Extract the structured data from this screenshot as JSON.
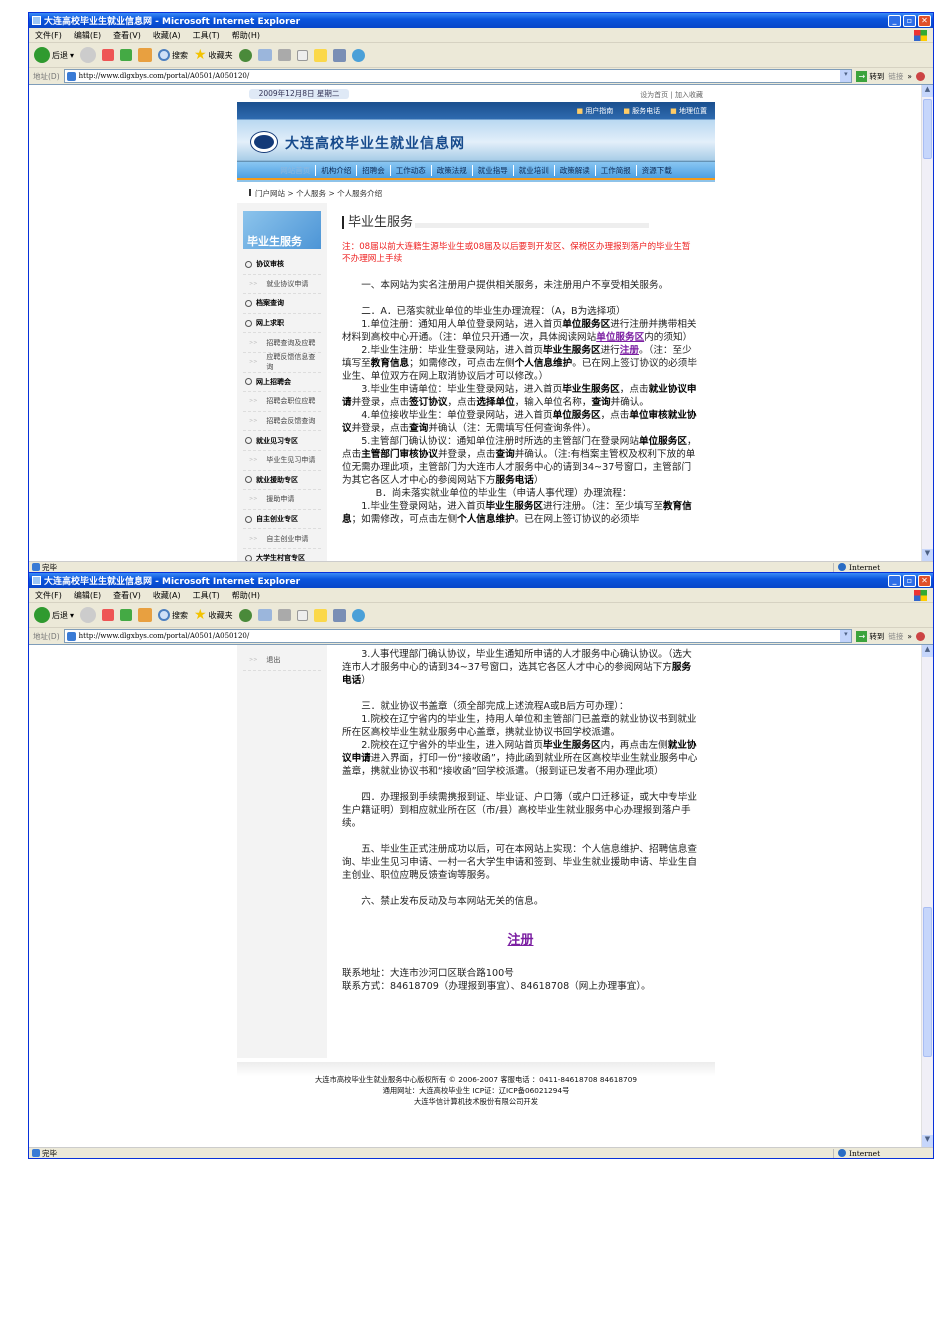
{
  "browser": {
    "title": "大连高校毕业生就业信息网 - Microsoft Internet Explorer",
    "menu": [
      "文件(F)",
      "编辑(E)",
      "查看(V)",
      "收藏(A)",
      "工具(T)",
      "帮助(H)"
    ],
    "toolbar": {
      "back": "后退",
      "search": "搜索",
      "favorites": "收藏夹"
    },
    "address": {
      "label": "地址(D)",
      "url": "http://www.dlgxbys.com/portal/A0501/A050120/",
      "go": "转到",
      "links": "链接"
    },
    "status": {
      "text": "完毕",
      "zone": "Internet"
    }
  },
  "page": {
    "date": "2009年12月8日 星期二",
    "top_links": [
      "设为首页",
      "加入收藏"
    ],
    "util_links": [
      "用户指南",
      "服务电话",
      "地理位置"
    ],
    "site_title": "大连高校毕业生就业信息网",
    "nav": [
      "网站首页",
      "机构介绍",
      "招聘会",
      "工作动态",
      "政策法规",
      "就业指导",
      "就业培训",
      "政策解读",
      "工作简报",
      "资源下载"
    ],
    "breadcrumb": [
      "门户网站",
      "个人服务",
      "个人服务介绍"
    ],
    "sidebar": {
      "header": "毕业生服务",
      "items": [
        {
          "label": "协议审核",
          "type": "sec"
        },
        {
          "label": "就业协议申请",
          "type": "sub"
        },
        {
          "label": "档案查询",
          "type": "sec"
        },
        {
          "label": "网上求职",
          "type": "sec"
        },
        {
          "label": "招聘查询及应聘",
          "type": "sub"
        },
        {
          "label": "应聘反馈信息查询",
          "type": "sub"
        },
        {
          "label": "网上招聘会",
          "type": "sec"
        },
        {
          "label": "招聘会职位应聘",
          "type": "sub"
        },
        {
          "label": "招聘会反馈查询",
          "type": "sub"
        },
        {
          "label": "就业见习专区",
          "type": "sec"
        },
        {
          "label": "毕业生见习申请",
          "type": "sub"
        },
        {
          "label": "就业援助专区",
          "type": "sec"
        },
        {
          "label": "援助申请",
          "type": "sub"
        },
        {
          "label": "自主创业专区",
          "type": "sec"
        },
        {
          "label": "自主创业申请",
          "type": "sub"
        },
        {
          "label": "大学生村官专区",
          "type": "sec"
        }
      ],
      "logout": "退出"
    },
    "main_title": "毕业生服务",
    "notice": "注：08届以前大连籍生源毕业生或08届及以后要到开发区、保税区办理报到落户的毕业生暂不办理网上手续",
    "paras_top": [
      {
        "cls": "",
        "seg": [
          [
            "t",
            "一、本网站为实名注册用户提供相关服务，未注册用户不享受相关服务。"
          ]
        ]
      },
      {
        "cls": "gap",
        "seg": [
          [
            "t",
            "二．A．已落实就业单位的毕业生办理流程：（A，B为选择项）"
          ]
        ]
      },
      {
        "cls": "",
        "seg": [
          [
            "t",
            "1.单位注册：通知用人单位登录网站，进入首页"
          ],
          [
            "b",
            "单位服务区"
          ],
          [
            "t",
            "进行注册并携带相关材料到高校中心开通。（注：单位只开通一次，具体阅读网站"
          ],
          [
            "a",
            "单位服务区"
          ],
          [
            "t",
            "内的须知）"
          ]
        ]
      },
      {
        "cls": "",
        "seg": [
          [
            "t",
            "2.毕业生注册：毕业生登录网站，进入首页"
          ],
          [
            "b",
            "毕业生服务区"
          ],
          [
            "t",
            "进行"
          ],
          [
            "a",
            "注册"
          ],
          [
            "t",
            "。（注：至少填写至"
          ],
          [
            "b",
            "教育信息"
          ],
          [
            "t",
            "；如需修改，可点击左侧"
          ],
          [
            "b",
            "个人信息维护"
          ],
          [
            "t",
            "。已在网上签订协议的必须毕业生、单位双方在网上取消协议后才可以修改。）"
          ]
        ]
      },
      {
        "cls": "",
        "seg": [
          [
            "t",
            "3.毕业生申请单位：毕业生登录网站，进入首页"
          ],
          [
            "b",
            "毕业生服务区"
          ],
          [
            "t",
            "，点击"
          ],
          [
            "b",
            "就业协议申请"
          ],
          [
            "t",
            "并登录，点击"
          ],
          [
            "b",
            "签订协议"
          ],
          [
            "t",
            "，点击"
          ],
          [
            "b",
            "选择单位"
          ],
          [
            "t",
            "，输入单位名称，"
          ],
          [
            "b",
            "查询"
          ],
          [
            "t",
            "并确认。"
          ]
        ]
      },
      {
        "cls": "",
        "seg": [
          [
            "t",
            "4.单位接收毕业生：单位登录网站，进入首页"
          ],
          [
            "b",
            "单位服务区"
          ],
          [
            "t",
            "，点击"
          ],
          [
            "b",
            "单位审核就业协议"
          ],
          [
            "t",
            "并登录，点击"
          ],
          [
            "b",
            "查询"
          ],
          [
            "t",
            "并确认（注：无需填写任何查询条件）。"
          ]
        ]
      },
      {
        "cls": "",
        "seg": [
          [
            "t",
            "5.主管部门确认协议：通知单位注册时所选的主管部门在登录网站"
          ],
          [
            "b",
            "单位服务区"
          ],
          [
            "t",
            "，点击"
          ],
          [
            "b",
            "主管部门审核协议"
          ],
          [
            "t",
            "并登录，点击"
          ],
          [
            "b",
            "查询"
          ],
          [
            "t",
            "并确认。（注:有档案主管权及权利下放的单位无需办理此项，主管部门为大连市人才服务中心的请到34~37号窗口，主管部门为其它各区人才中心的参阅网站下方"
          ],
          [
            "b",
            "服务电话"
          ],
          [
            "t",
            "）"
          ]
        ]
      },
      {
        "cls": "indB",
        "seg": [
          [
            "t",
            "B．尚未落实就业单位的毕业生（申请人事代理）办理流程："
          ]
        ]
      },
      {
        "cls": "",
        "seg": [
          [
            "t",
            "1.毕业生登录网站，进入首页"
          ],
          [
            "b",
            "毕业生服务区"
          ],
          [
            "t",
            "进行注册。（注：至少填写至"
          ],
          [
            "b",
            "教育信息"
          ],
          [
            "t",
            "；如需修改，可点击左侧"
          ],
          [
            "b",
            "个人信息维护"
          ],
          [
            "t",
            "。已在网上签订协议的必须毕"
          ]
        ]
      }
    ],
    "paras_bottom": [
      {
        "cls": "",
        "seg": [
          [
            "t",
            "3.人事代理部门确认协议，毕业生通知所申请的人才服务中心确认协议。（选大连市人才服务中心的请到34~37号窗口，选其它各区人才中心的参阅网站下方"
          ],
          [
            "b",
            "服务电话"
          ],
          [
            "t",
            "）"
          ]
        ]
      },
      {
        "cls": "gap",
        "seg": [
          [
            "t",
            "三．就业协议书盖章（须全部完成上述流程A或B后方可办理）："
          ]
        ]
      },
      {
        "cls": "",
        "seg": [
          [
            "t",
            "1.院校在辽宁省内的毕业生，持用人单位和主管部门已盖章的就业协议书到就业所在区高校毕业生就业服务中心盖章，携就业协议书回学校派遣。"
          ]
        ]
      },
      {
        "cls": "",
        "seg": [
          [
            "t",
            "2.院校在辽宁省外的毕业生，进入网站首页"
          ],
          [
            "b",
            "毕业生服务区"
          ],
          [
            "t",
            "内，再点击左侧"
          ],
          [
            "b",
            "就业协议申请"
          ],
          [
            "t",
            "进入界面，打印一份“接收函”，持此函到就业所在区高校毕业生就业服务中心盖章，携就业协议书和“接收函”回学校派遣。（报到证已发者不用办理此项）"
          ]
        ]
      },
      {
        "cls": "gap",
        "seg": [
          [
            "t",
            "四．办理报到手续需携报到证、毕业证、户口簿（或户口迁移证，或大中专毕业生户籍证明）到相应就业所在区（市/县）高校毕业生就业服务中心办理报到落户手续。"
          ]
        ]
      },
      {
        "cls": "gap",
        "seg": [
          [
            "t",
            "五、毕业生正式注册成功以后，可在本网站上实现：个人信息维护、招聘信息查询、毕业生见习申请、一村一名大学生申请和签到、毕业生就业援助申请、毕业生自主创业、职位应聘反馈查询等服务。"
          ]
        ]
      },
      {
        "cls": "gap",
        "seg": [
          [
            "t",
            "六、禁止发布反动及与本网站无关的信息。"
          ]
        ]
      }
    ],
    "register_link": "注册",
    "contact": [
      "联系地址：大连市沙河口区联合路100号",
      "联系方式：84618709（办理报到事宜）、84618708（网上办理事宜）。"
    ],
    "footer": [
      "大连市高校毕业生就业服务中心版权所有 © 2006-2007 客服电话 ：0411-84618708 84618709",
      "通用网址：大连高校毕业生 ICP证：辽ICP备06021294号",
      "大连华信计算机技术股份有限公司开发"
    ]
  }
}
